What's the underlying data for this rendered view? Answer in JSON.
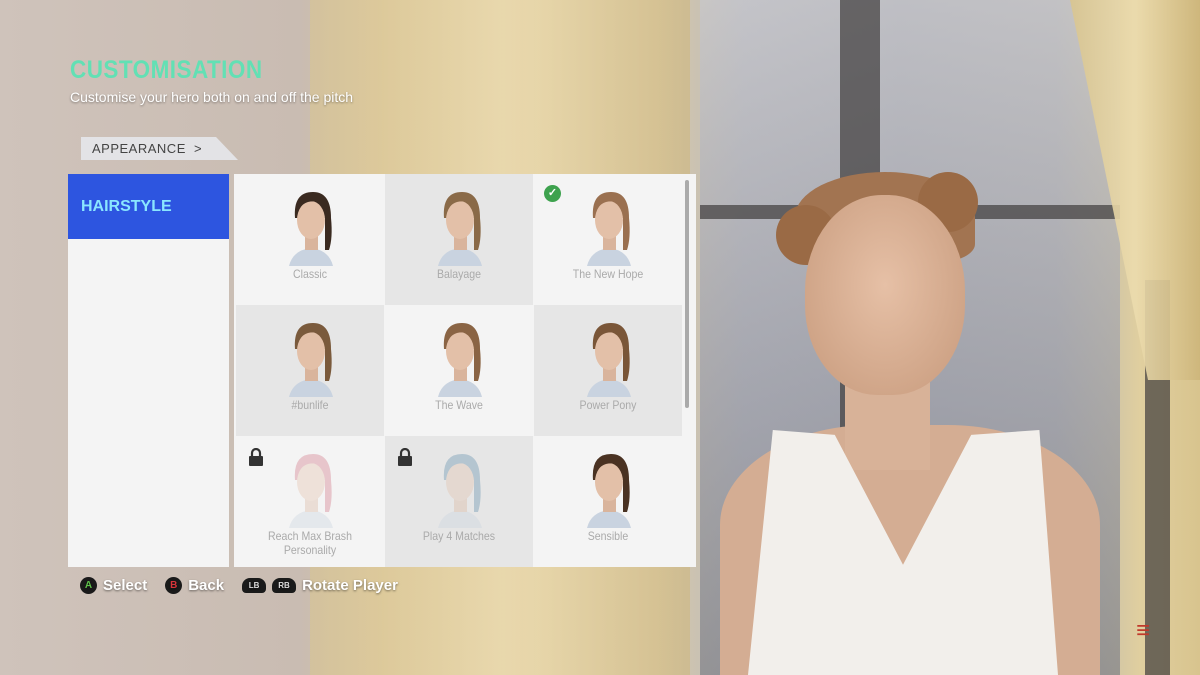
{
  "header": {
    "title": "CUSTOMISATION",
    "subtitle": "Customise your hero both on and off the pitch"
  },
  "breadcrumb": {
    "label": "APPEARANCE",
    "chevron": ">"
  },
  "sidebar": {
    "items": [
      {
        "label": "HAIRSTYLE",
        "selected": true
      }
    ]
  },
  "hairstyles": [
    {
      "label": "Classic",
      "hair": "#3a2a20",
      "locked": false,
      "selected": false
    },
    {
      "label": "Balayage",
      "hair": "#8a6a48",
      "locked": false,
      "selected": false
    },
    {
      "label": "The New Hope",
      "hair": "#9a7050",
      "locked": false,
      "selected": true
    },
    {
      "label": "#bunlife",
      "hair": "#7a5a3c",
      "locked": false,
      "selected": false
    },
    {
      "label": "The Wave",
      "hair": "#8a6444",
      "locked": false,
      "selected": false
    },
    {
      "label": "Power Pony",
      "hair": "#7a5638",
      "locked": false,
      "selected": false
    },
    {
      "label": "Reach Max Brash Personality",
      "hair": "#d07080",
      "locked": true,
      "selected": false
    },
    {
      "label": "Play 4 Matches",
      "hair": "#5a8aa8",
      "locked": true,
      "selected": false
    },
    {
      "label": "Sensible",
      "hair": "#4a3222",
      "locked": false,
      "selected": false
    }
  ],
  "hints": [
    {
      "button": "A",
      "label": "Select",
      "color": "#5fc04a"
    },
    {
      "button": "B",
      "label": "Back",
      "color": "#d8343a"
    },
    {
      "buttons": [
        "LB",
        "RB"
      ],
      "label": "Rotate Player"
    }
  ],
  "icons": {
    "selected": "check-circle-icon",
    "locked": "lock-icon"
  },
  "colors": {
    "accent": "#62e0b4",
    "selected_tab": "#2d55e0"
  }
}
